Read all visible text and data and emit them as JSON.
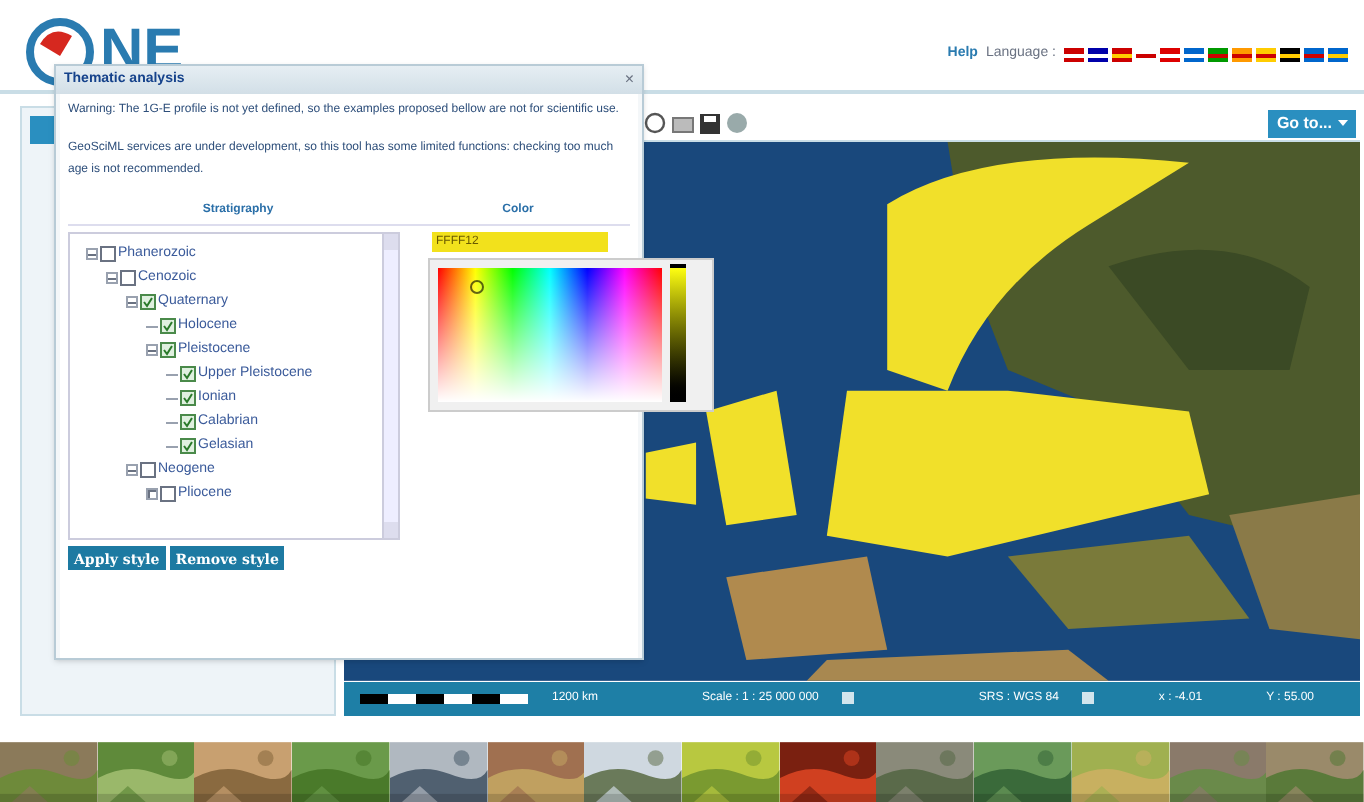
{
  "header": {
    "logo_text": "NE",
    "help_link": "Help",
    "language_label": "Language :"
  },
  "dialog": {
    "title": "Thematic analysis",
    "close": "×",
    "warnings": [
      "Warning: The 1G-E profile is not yet defined, so the examples proposed bellow are not for scientific use.",
      "GeoSciML services are under development, so this tool has some limited functions: checking too much age is not recommended."
    ],
    "columns": [
      "Stratigraphy",
      "Color"
    ],
    "tree": [
      {
        "label": "Phanerozoic",
        "checked": false,
        "expanded": true,
        "children": [
          {
            "label": "Cenozoic",
            "checked": false,
            "expanded": true,
            "children": [
              {
                "label": "Quaternary",
                "checked": true,
                "expanded": true,
                "children": [
                  {
                    "label": "Holocene",
                    "checked": true
                  },
                  {
                    "label": "Pleistocene",
                    "checked": true,
                    "expanded": true,
                    "children": [
                      {
                        "label": "Upper Pleistocene",
                        "checked": true
                      },
                      {
                        "label": "Ionian",
                        "checked": true
                      },
                      {
                        "label": "Calabrian",
                        "checked": true
                      },
                      {
                        "label": "Gelasian",
                        "checked": true
                      }
                    ]
                  }
                ]
              },
              {
                "label": "Neogene",
                "checked": false,
                "expanded": true,
                "children": [
                  {
                    "label": "Pliocene",
                    "checked": false,
                    "expanded": false
                  }
                ]
              }
            ]
          }
        ]
      }
    ],
    "color_value": "FFFF12",
    "color": "#f2e11c",
    "brightness": {
      "level": 1
    },
    "buttons": [
      "Apply style",
      "Remove style"
    ]
  },
  "map": {
    "goto_button": "Go to...",
    "scale_distance": "1200 km",
    "scale": "Scale : 1 : 25 000 000",
    "srs": "SRS : WGS 84",
    "x": "x : -4.01",
    "y": "Y : 55.00"
  }
}
